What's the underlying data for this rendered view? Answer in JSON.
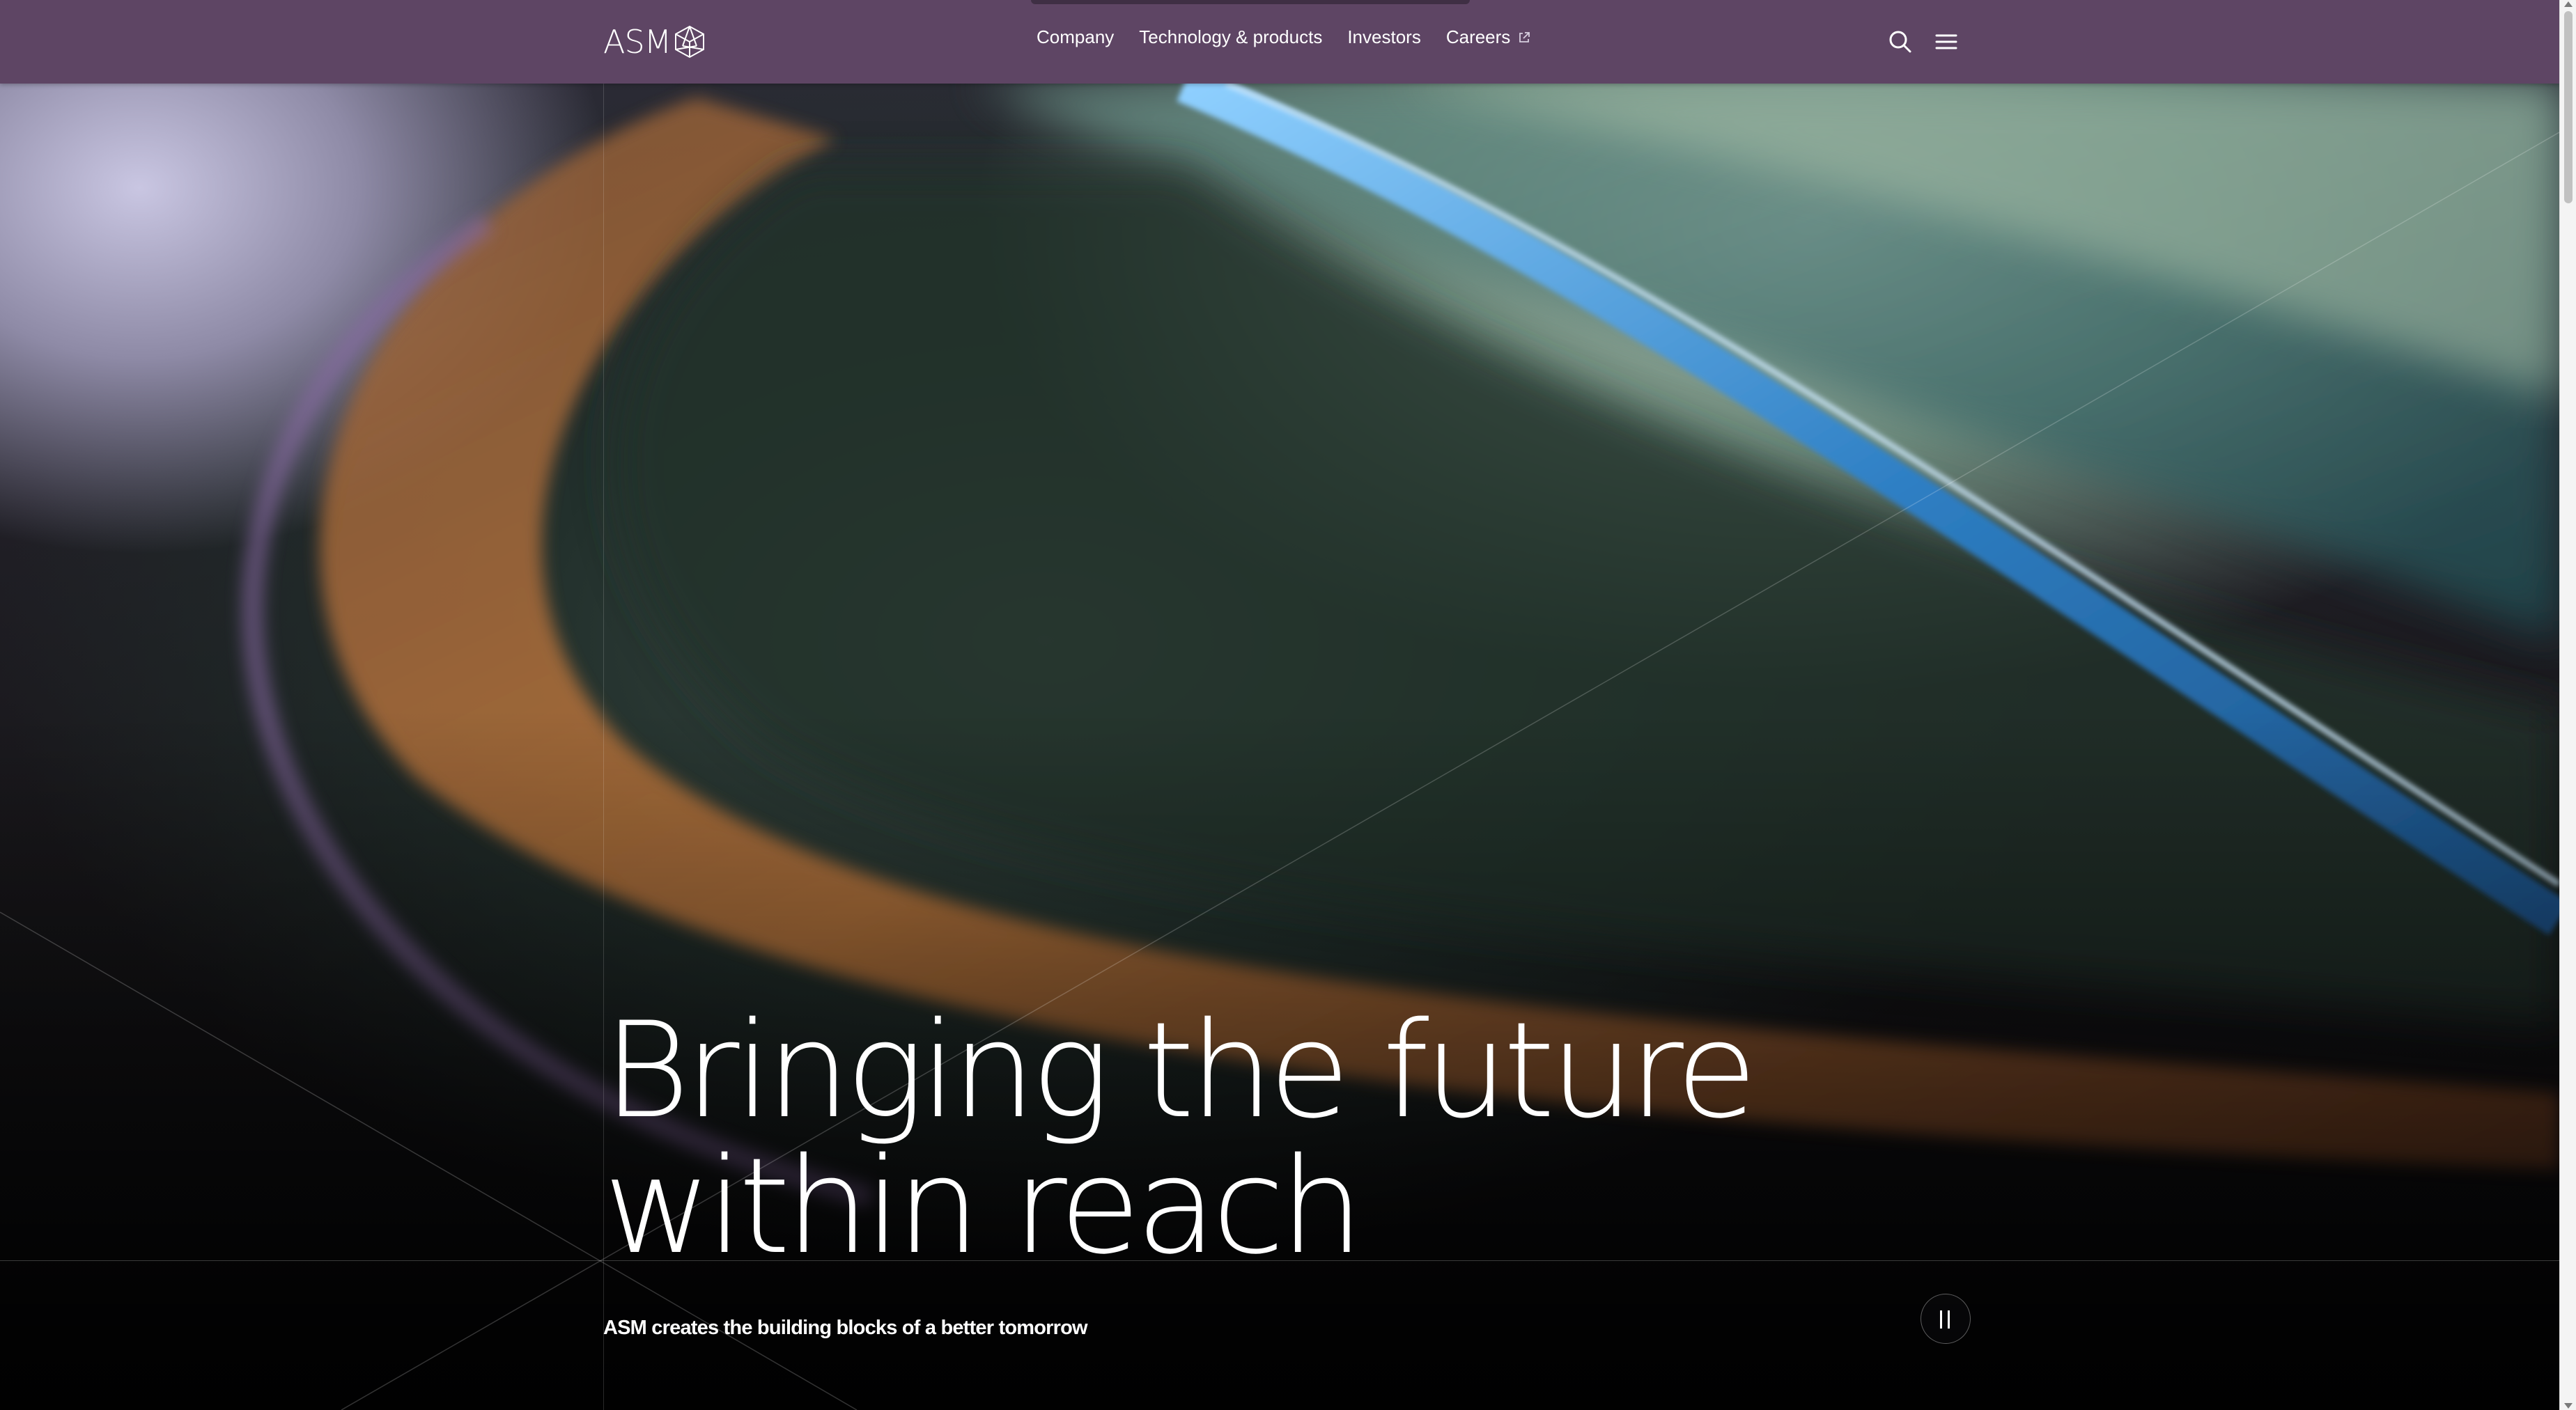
{
  "brand": {
    "logo_text": "ASM",
    "header_color": "#5e4564"
  },
  "nav": {
    "items": [
      {
        "label": "Company"
      },
      {
        "label": "Technology & products"
      },
      {
        "label": "Investors"
      },
      {
        "label": "Careers",
        "icon": "external-link-icon"
      }
    ]
  },
  "header_icons": [
    "search-icon",
    "menu-icon"
  ],
  "hero": {
    "headline_line1": "Bringing the future",
    "headline_line2": "within reach",
    "tagline": "ASM creates the building blocks of a better tomorrow",
    "pause_icon": "pause-icon"
  }
}
